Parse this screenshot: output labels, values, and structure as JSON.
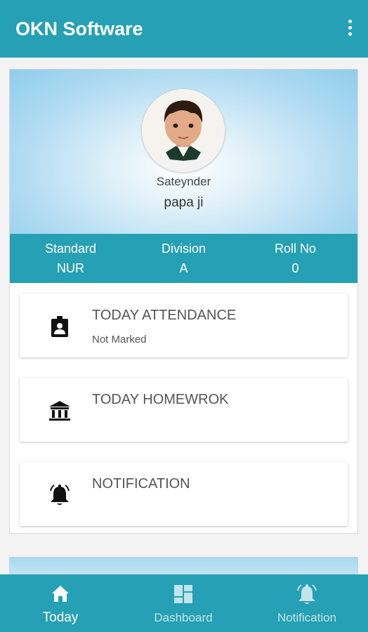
{
  "app": {
    "title": "OKN Software"
  },
  "profile": {
    "student_name": "Sateynder",
    "parent_name": "papa ji",
    "info": [
      {
        "label": "Standard",
        "value": "NUR"
      },
      {
        "label": "Division",
        "value": "A"
      },
      {
        "label": "Roll No",
        "value": "0"
      }
    ]
  },
  "items": [
    {
      "title": "TODAY ATTENDANCE",
      "subtitle": "Not Marked",
      "icon": "id-badge-icon"
    },
    {
      "title": "TODAY HOMEWROK",
      "icon": "institution-icon"
    },
    {
      "title": "NOTIFICATION",
      "icon": "bell-icon"
    }
  ],
  "bottom_nav": [
    {
      "label": "Today",
      "icon": "home-icon",
      "active": true
    },
    {
      "label": "Dashboard",
      "icon": "dashboard-icon",
      "active": false
    },
    {
      "label": "Notification",
      "icon": "bell-icon",
      "active": false
    }
  ],
  "colors": {
    "primary": "#26a0b4",
    "hero_light": "#dff0f9",
    "hero_dark": "#8fcdec"
  }
}
